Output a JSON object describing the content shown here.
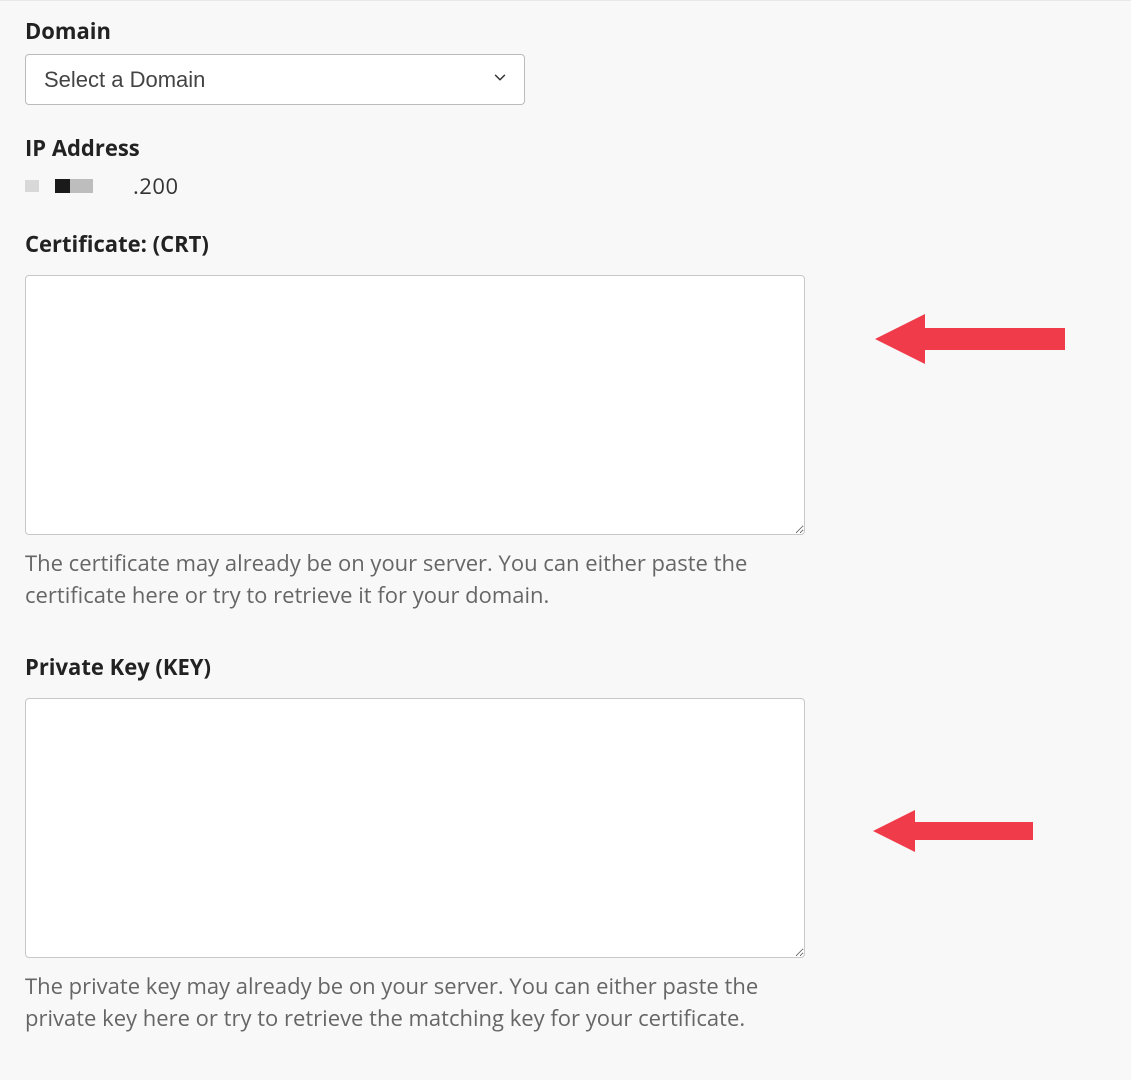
{
  "domain": {
    "label": "Domain",
    "placeholder": "Select a Domain"
  },
  "ip": {
    "label": "IP Address",
    "suffix": ".200"
  },
  "certificate": {
    "label": "Certificate: (CRT)",
    "value": "",
    "help": "The certificate may already be on your server. You can either paste the certificate here or try to retrieve it for your domain."
  },
  "private_key": {
    "label": "Private Key (KEY)",
    "value": "",
    "help": "The private key may already be on your server. You can either paste the private key here or try to retrieve the matching key for your certificate."
  },
  "annotations": {
    "arrow_color": "#ef3b4a"
  }
}
